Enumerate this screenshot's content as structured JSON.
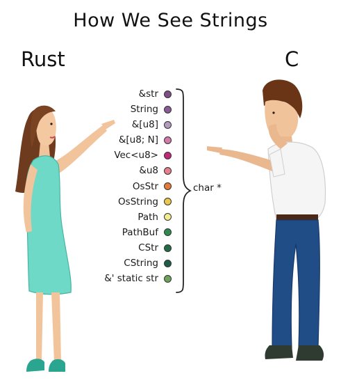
{
  "title": "How We See Strings",
  "left_label": "Rust",
  "right_label": "C",
  "target_label": "char *",
  "rust_types": [
    {
      "name": "&str",
      "color": "#7b4f86"
    },
    {
      "name": "String",
      "color": "#8a5a95"
    },
    {
      "name": "&[u8]",
      "color": "#b39abf"
    },
    {
      "name": "&[u8; N]",
      "color": "#d27aa8"
    },
    {
      "name": "Vec<u8>",
      "color": "#c0287a"
    },
    {
      "name": "&u8",
      "color": "#e57e8d"
    },
    {
      "name": "OsStr",
      "color": "#e37a3a"
    },
    {
      "name": "OsString",
      "color": "#e8c94d"
    },
    {
      "name": "Path",
      "color": "#f2ec8c"
    },
    {
      "name": "PathBuf",
      "color": "#2f8a4e"
    },
    {
      "name": "CStr",
      "color": "#226b46"
    },
    {
      "name": "CString",
      "color": "#1f5c45"
    },
    {
      "name": "&' static str",
      "color": "#6fa35b"
    }
  ],
  "icons": {
    "woman": "woman-pointing-figure",
    "man": "man-pointing-figure",
    "brace": "curly-brace-icon"
  }
}
